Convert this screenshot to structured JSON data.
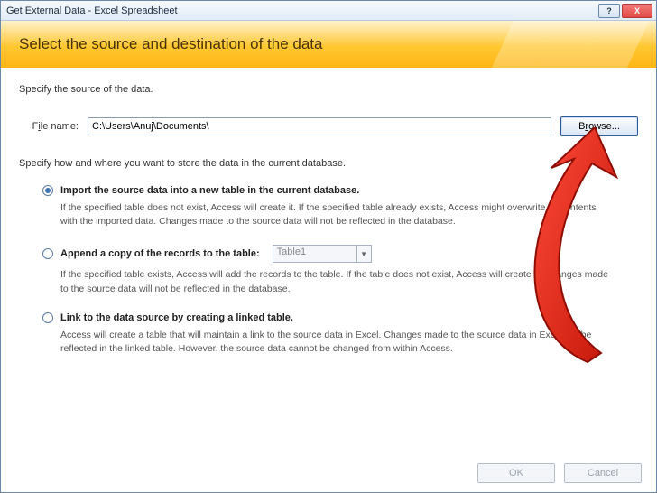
{
  "window": {
    "title": "Get External Data - Excel Spreadsheet",
    "help": "?",
    "close": "X"
  },
  "banner": {
    "heading": "Select the source and destination of the data"
  },
  "source": {
    "specify": "Specify the source of the data.",
    "file_label_pre": "F",
    "file_label_u": "i",
    "file_label_post": "le name:",
    "file_value": "C:\\Users\\Anuj\\Documents\\",
    "browse_pre": "B",
    "browse_u": "r",
    "browse_post": "owse..."
  },
  "store": {
    "specify": "Specify how and where you want to store the data in the current database."
  },
  "options": {
    "opt1": {
      "label": "Import the source data into a new table in the current database.",
      "desc": "If the specified table does not exist, Access will create it. If the specified table already exists, Access might overwrite its contents with the imported data. Changes made to the source data will not be reflected in the database."
    },
    "opt2": {
      "label": "Append a copy of the records to the table:",
      "table": "Table1",
      "desc": "If the specified table exists, Access will add the records to the table. If the table does not exist, Access will create it. Changes made to the source data will not be reflected in the database."
    },
    "opt3": {
      "label": "Link to the data source by creating a linked table.",
      "desc": "Access will create a table that will maintain a link to the source data in Excel. Changes made to the source data in Excel will be reflected in the linked table. However, the source data cannot be changed from within Access."
    }
  },
  "footer": {
    "ok": "OK",
    "cancel": "Cancel"
  }
}
